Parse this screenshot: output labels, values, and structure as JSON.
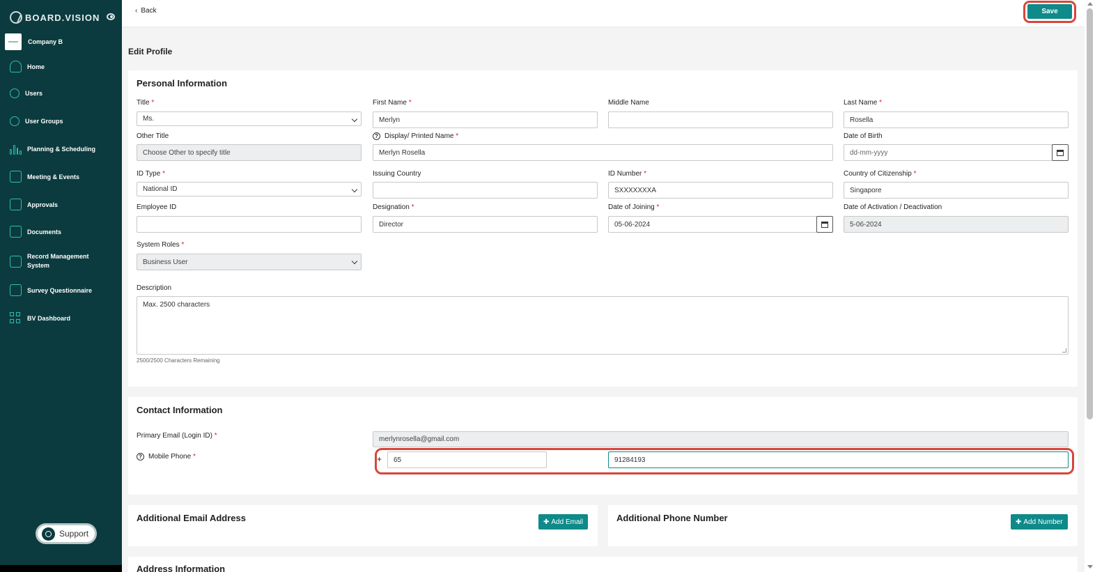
{
  "brand": {
    "name": "BOARD.VISION",
    "accent": "#0e8a8a",
    "sidebar_bg": "#0b3b3f"
  },
  "sidebar": {
    "company": "Company B",
    "items": [
      {
        "label": "Home",
        "icon": "home-icon"
      },
      {
        "label": "Users",
        "icon": "user-icon"
      },
      {
        "label": "User Groups",
        "icon": "users-icon"
      },
      {
        "label": "Planning & Scheduling",
        "icon": "chart-bars-icon"
      },
      {
        "label": "Meeting & Events",
        "icon": "calendar-icon"
      },
      {
        "label": "Approvals",
        "icon": "document-icon"
      },
      {
        "label": "Documents",
        "icon": "documents-icon"
      },
      {
        "label": "Record Management System",
        "icon": "records-icon"
      },
      {
        "label": "Survey Questionnaire",
        "icon": "survey-icon"
      },
      {
        "label": "BV Dashboard",
        "icon": "dashboard-grid-icon"
      }
    ],
    "support": "Support"
  },
  "topbar": {
    "back": "Back",
    "save": "Save"
  },
  "page_title": "Edit Profile",
  "personal": {
    "title": "Personal Information",
    "fields": {
      "title": {
        "label": "Title",
        "value": "Ms."
      },
      "first_name": {
        "label": "First Name",
        "value": "Merlyn"
      },
      "middle_name": {
        "label": "Middle Name",
        "value": ""
      },
      "last_name": {
        "label": "Last Name",
        "value": "Rosella"
      },
      "other_title": {
        "label": "Other Title",
        "placeholder": "Choose Other to specify title"
      },
      "display_name": {
        "label": "Display/ Printed Name",
        "value": "Merlyn Rosella"
      },
      "dob": {
        "label": "Date of Birth",
        "placeholder": "dd-mm-yyyy"
      },
      "id_type": {
        "label": "ID Type",
        "value": "National ID"
      },
      "issuing_country": {
        "label": "Issuing Country",
        "value": ""
      },
      "id_number": {
        "label": "ID Number",
        "value": "SXXXXXXXA"
      },
      "citizenship": {
        "label": "Country of Citizenship",
        "value": "Singapore"
      },
      "employee_id": {
        "label": "Employee ID",
        "value": ""
      },
      "designation": {
        "label": "Designation",
        "value": "Director"
      },
      "date_joining": {
        "label": "Date of Joining",
        "value": "05-06-2024"
      },
      "date_activation": {
        "label": "Date of Activation / Deactivation",
        "value": "5-06-2024"
      },
      "system_roles": {
        "label": "System Roles",
        "value": "Business User"
      },
      "description": {
        "label": "Description",
        "placeholder": "Max. 2500 characters",
        "remaining": "2500/2500 Characters Remaining"
      }
    }
  },
  "contact": {
    "title": "Contact Information",
    "primary_email": {
      "label": "Primary Email (Login ID)",
      "value": "merlynrosella@gmail.com"
    },
    "mobile": {
      "label": "Mobile Phone",
      "prefix": "+",
      "country_code": "65",
      "number": "91284193"
    }
  },
  "additional_email": {
    "title": "Additional Email Address",
    "button": "Add Email"
  },
  "additional_phone": {
    "title": "Additional Phone Number",
    "button": "Add Number"
  },
  "address": {
    "title": "Address Information"
  }
}
